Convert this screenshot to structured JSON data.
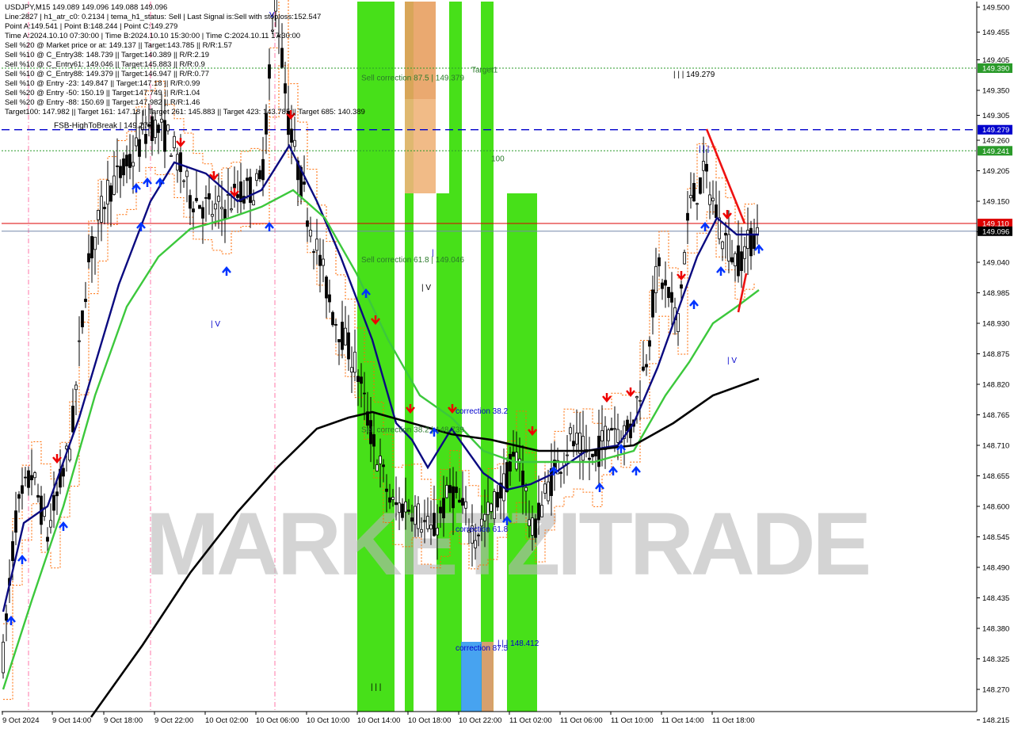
{
  "header": {
    "symbol_line": "USDJPY,M15  149.089 149.096 149.088 149.096",
    "lines": [
      "Line:2827  |  h1_atr_c0: 0.2134  |  tema_h1_status: Sell  |  Last Signal is:Sell with stoploss:152.547",
      "Point A:149.541  |  Point B:148.244  |  Point C:149.279",
      "Time A:2024.10.10 07:30:00  |  Time B:2024.10.10 15:30:00  |  Time C:2024.10.11 17:30:00",
      "Sell %20 @ Market price or at: 149.137  ||  Target:143.785  ||  R/R:1.57",
      "Sell %10 @ C_Entry38: 148.739  ||  Target:140.389  ||  R/R:2.19",
      "Sell %10 @ C_Entry61: 149.046  ||  Target:145.883  ||  R/R:0.9",
      "Sell %10 @ C_Entry88: 149.379  ||  Target:146.947  ||  R/R:0.77",
      "Sell %10 @ Entry -23: 149.847  ||  Target:147.18  ||  R/R:0.99",
      "Sell %20 @ Entry -50: 150.19  ||  Target:147.749  ||  R/R:1.04",
      "Sell %20 @ Entry -88: 150.69  ||  Target:147.982  ||  R/R:1.46",
      "Target100: 147.982  ||  Target 161: 147.18  ||  Target 261: 145.883  ||  Target 423: 143.785  ||  Target 685: 140.389"
    ]
  },
  "watermark": "MARKETZITRADE",
  "colors": {
    "candle": "#000000",
    "ma_blue": "#0a0a80",
    "ma_green": "#3cc83c",
    "ma_black": "#000000",
    "zone_green": "#33dd00",
    "zone_orange": "#e8a060",
    "zone_blue": "#3399ee",
    "level_green": "#2a9a2a",
    "level_blue": "#0000cc",
    "level_red": "#dd0000",
    "level_gray": "#7788aa",
    "arrow_red": "#ee0000",
    "arrow_blue": "#0033ff"
  },
  "chart_data": {
    "type": "candlestick",
    "symbol": "USDJPY",
    "timeframe": "M15",
    "ylim": [
      148.23,
      149.51
    ],
    "y_ticks": [
      "149.500",
      "149.455",
      "149.405",
      "149.350",
      "149.305",
      "149.260",
      "149.205",
      "149.150",
      "149.095",
      "149.040",
      "148.985",
      "148.930",
      "148.875",
      "148.820",
      "148.765",
      "148.710",
      "148.655",
      "148.600",
      "148.545",
      "148.490",
      "148.435",
      "148.380",
      "148.325",
      "148.270",
      "148.215"
    ],
    "x_ticks": [
      "9 Oct 2024",
      "9 Oct 14:00",
      "9 Oct 18:00",
      "9 Oct 22:00",
      "10 Oct 02:00",
      "10 Oct 06:00",
      "10 Oct 10:00",
      "10 Oct 14:00",
      "10 Oct 18:00",
      "10 Oct 22:00",
      "11 Oct 02:00",
      "11 Oct 06:00",
      "11 Oct 10:00",
      "11 Oct 14:00",
      "11 Oct 18:00"
    ],
    "price_tags": [
      {
        "label": "149.390",
        "value": 149.39,
        "color": "#2a9a2a"
      },
      {
        "label": "149.279",
        "value": 149.279,
        "color": "#0000cc"
      },
      {
        "label": "149.241",
        "value": 149.241,
        "color": "#2a9a2a"
      },
      {
        "label": "149.110",
        "value": 149.11,
        "color": "#dd0000"
      },
      {
        "label": "149.096",
        "value": 149.096,
        "color": "#000000"
      }
    ],
    "levels": [
      {
        "value": 149.39,
        "style": "dotted",
        "color": "#2a9a2a"
      },
      {
        "value": 149.279,
        "style": "dashed",
        "color": "#0000cc"
      },
      {
        "value": 149.241,
        "style": "dotted",
        "color": "#2a9a2a"
      },
      {
        "value": 149.11,
        "style": "solid",
        "color": "#dd0000"
      },
      {
        "value": 149.096,
        "style": "solid",
        "color": "#7788aa"
      }
    ],
    "annotations": [
      {
        "text": "FSB-HighToBreak  |  149.279",
        "color": "#000000"
      },
      {
        "text": "Sell correction 87.5 | 149.379",
        "color": "#2a7a2a"
      },
      {
        "text": "Target1",
        "color": "#2a7a2a"
      },
      {
        "text": "100",
        "color": "#2a7a2a"
      },
      {
        "text": "Sell correction 61.8 | 149.046",
        "color": "#2a7a2a"
      },
      {
        "text": "Sell correction 38.2 | 148.739",
        "color": "#2a7a2a"
      },
      {
        "text": "correction 38.2",
        "color": "#0000cc"
      },
      {
        "text": "correction 61.8",
        "color": "#0000cc"
      },
      {
        "text": "correction 87.5",
        "color": "#0000cc"
      },
      {
        "text": "| | | 149.279",
        "color": "#000000"
      },
      {
        "text": "| | | 148.412",
        "color": "#0000cc"
      },
      {
        "text": "| | |",
        "color": "#0000cc"
      },
      {
        "text": "| V",
        "color": "#0000cc"
      },
      {
        "text": "| V",
        "color": "#0000cc"
      },
      {
        "text": "| | |",
        "color": "#000000"
      },
      {
        "text": "|",
        "color": "#0000cc"
      },
      {
        "text": "V",
        "color": "#0000cc"
      },
      {
        "text": "| V",
        "color": "#000000"
      }
    ]
  }
}
